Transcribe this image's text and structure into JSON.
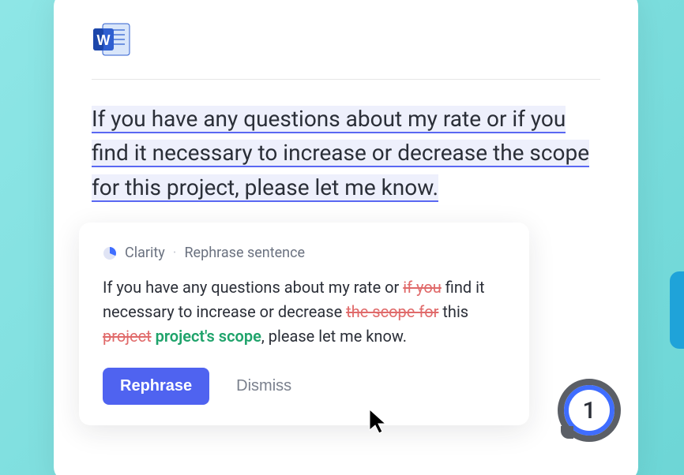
{
  "document": {
    "highlighted_text": "If you have any questions about my rate or if you find it necessary to increase or decrease the scope for this project, please let me know."
  },
  "suggestion": {
    "category": "Clarity",
    "action_label": "Rephrase sentence",
    "body": {
      "seg1": "If you have any questions about my rate or ",
      "strike1": "if you",
      "seg2": " find it necessary to increase or decrease ",
      "strike2": "the scope for",
      "seg3": " this ",
      "strike3": "project",
      "insert1": " project's scope",
      "seg4": ", please let me know."
    },
    "buttons": {
      "primary": "Rephrase",
      "dismiss": "Dismiss"
    }
  },
  "fab": {
    "count": "1"
  },
  "icons": {
    "word": "word-icon",
    "clarity": "pie-chart-icon"
  }
}
